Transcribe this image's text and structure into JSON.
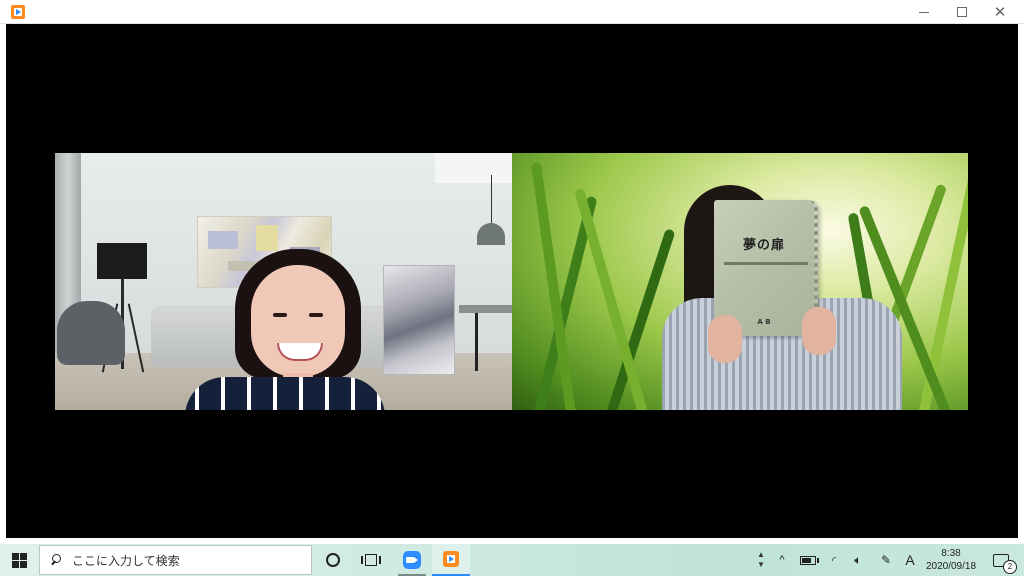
{
  "window": {
    "title": "",
    "app_icon": "video-player-icon"
  },
  "video_call": {
    "participants": [
      {
        "position": "left",
        "scene": "living-room-virtual-background"
      },
      {
        "position": "right",
        "scene": "green-grass-virtual-background"
      }
    ],
    "book": {
      "title": "夢の扉",
      "author": "A B"
    }
  },
  "taskbar": {
    "search_placeholder": "ここに入力して検索",
    "pinned_apps": [
      "cortana-icon",
      "task-view-icon",
      "zoom-icon",
      "video-player-icon"
    ],
    "tray": {
      "ime_label": "A",
      "time": "8:38",
      "date": "2020/09/18",
      "notification_count": "2",
      "chevron": "^",
      "wifi_glyph": "◜",
      "volume_glyph": "🔈︎",
      "pen_glyph": "✎"
    }
  },
  "colors": {
    "zoom_blue": "#2d8cff",
    "player_orange": "#ff8a1f",
    "taskbar_bg": "#cfeae3"
  }
}
